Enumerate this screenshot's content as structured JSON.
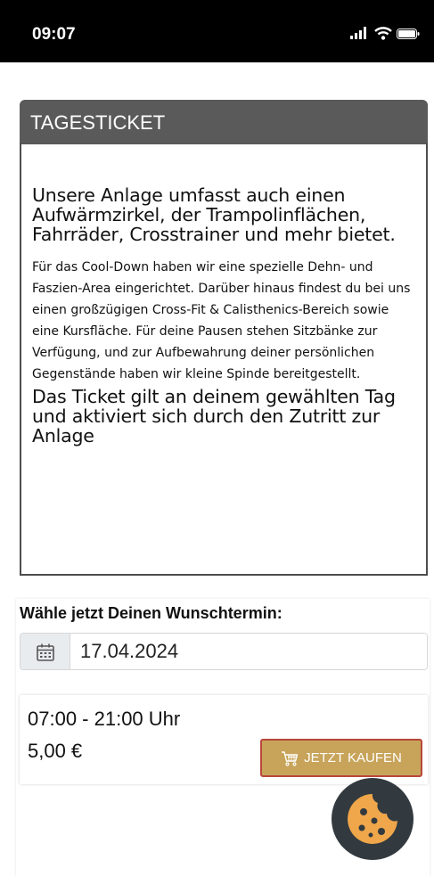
{
  "status_bar": {
    "time": "09:07"
  },
  "ticket_card": {
    "title": "TAGESTICKET",
    "lead": "Unsere Anlage umfasst auch einen Aufwärmzirkel, der Trampolinflächen, Fahrräder, Crosstrainer und mehr bietet.",
    "description": "Für das Cool-Down haben wir eine spezielle Dehn- und Faszien-Area eingerichtet. Darüber hinaus findest du bei uns einen großzügigen Cross-Fit & Calisthenics-Bereich sowie eine Kursfläche. Für deine Pausen stehen Sitzbänke zur Verfügung, und zur Aufbewahrung deiner persönlichen Gegenstände haben wir kleine Spinde bereitgestellt.",
    "validity": "Das Ticket gilt an deinem gewählten Tag und aktiviert sich durch den Zutritt zur Anlage"
  },
  "booking": {
    "heading": "Wähle jetzt Deinen Wunschtermin:",
    "date_value": "17.04.2024",
    "slot": {
      "time_range": "07:00 - 21:00 Uhr",
      "price": "5,00 €",
      "buy_label": "JETZT KAUFEN"
    }
  },
  "icons": {
    "calendar": "calendar-icon",
    "cart": "cart-icon",
    "cookie": "cookie-icon",
    "signal": "signal-icon",
    "wifi": "wifi-icon",
    "battery": "battery-icon"
  },
  "colors": {
    "header_bg": "#5a5a5a",
    "buy_button_bg": "#c8a45a",
    "buy_button_border": "#b8463a",
    "cookie_bg": "#333a3f",
    "cookie_fill": "#f0a64a"
  }
}
